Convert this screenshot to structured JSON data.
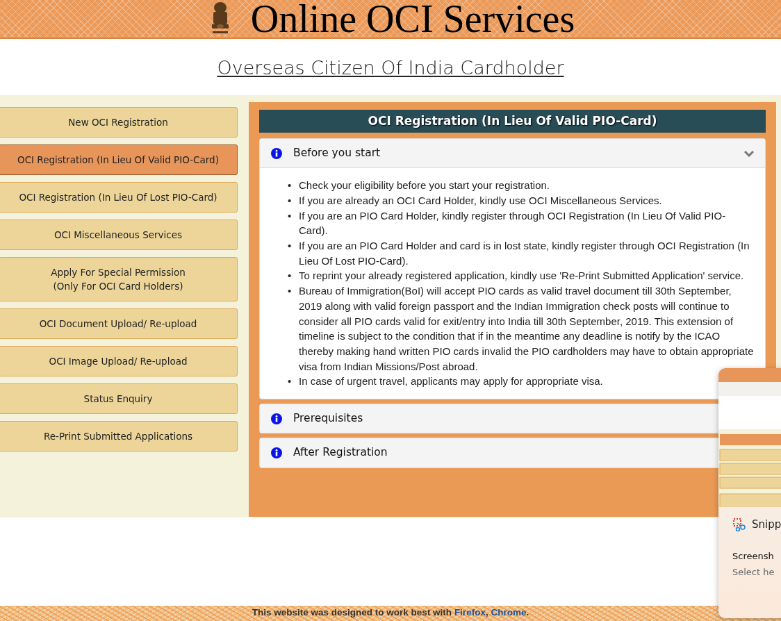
{
  "header": {
    "title": "Online OCI Services"
  },
  "page_title": "Overseas Citizen Of India Cardholder",
  "sidebar": {
    "items": [
      {
        "lines": [
          "New OCI Registration"
        ],
        "selected": false
      },
      {
        "lines": [
          "OCI Registration (In Lieu Of Valid PIO-Card)"
        ],
        "selected": true
      },
      {
        "lines": [
          "OCI Registration (In Lieu Of Lost PIO-Card)"
        ],
        "selected": false
      },
      {
        "lines": [
          "OCI Miscellaneous Services"
        ],
        "selected": false
      },
      {
        "lines": [
          "Apply For Special Permission",
          "(Only For OCI Card Holders)"
        ],
        "selected": false
      },
      {
        "lines": [
          "OCI Document Upload/ Re-upload"
        ],
        "selected": false
      },
      {
        "lines": [
          "OCI Image Upload/ Re-upload"
        ],
        "selected": false
      },
      {
        "lines": [
          "Status Enquiry"
        ],
        "selected": false
      },
      {
        "lines": [
          "Re-Print Submitted Applications"
        ],
        "selected": false
      }
    ]
  },
  "panel": {
    "heading": "OCI Registration (In Lieu Of Valid PIO-Card)",
    "accordion": [
      {
        "title": "Before you start",
        "expanded": true,
        "bullet": "•",
        "items": [
          "Check your eligibility before you start your registration.",
          "If you are already an OCI Card Holder, kindly use OCI Miscellaneous Services.",
          "If you are an PIO Card Holder, kindly register through OCI Registration (In Lieu Of Valid PIO-Card).",
          "If you are an PIO Card Holder and card is in lost state, kindly register through OCI Registration (In Lieu Of Lost PIO-Card).",
          "To reprint your already registered application, kindly use 'Re-Print Submitted Application' service.",
          "Bureau of Immigration(BoI) will accept PIO cards as valid travel document till 30th September, 2019 along with valid foreign passport and the Indian Immigration check posts will continue to consider all PIO cards valid for exit/entry into India till 30th September, 2019. This extension of timeline is subject to the condition that if in the meantime any deadline is notify by the ICAO thereby making hand written PIO cards invalid the PIO cardholders may have to obtain appropriate visa from Indian Missions/Post abroad.",
          "In case of urgent travel, applicants may apply for appropriate visa."
        ]
      },
      {
        "title": "Prerequisites",
        "expanded": false
      },
      {
        "title": "After Registration",
        "expanded": false
      }
    ]
  },
  "footer": {
    "lead": "This website was designed to work best with ",
    "links": [
      "Firefox",
      "Chrome"
    ],
    "separator": ", ",
    "end": "."
  },
  "notification": {
    "app": "Snipp",
    "title": "Screensh",
    "subtitle": "Select he"
  }
}
